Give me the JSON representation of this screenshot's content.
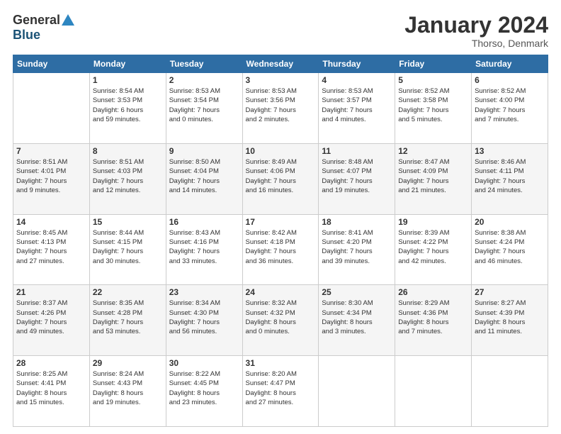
{
  "header": {
    "logo_general": "General",
    "logo_blue": "Blue",
    "title": "January 2024",
    "subtitle": "Thorso, Denmark"
  },
  "weekdays": [
    "Sunday",
    "Monday",
    "Tuesday",
    "Wednesday",
    "Thursday",
    "Friday",
    "Saturday"
  ],
  "weeks": [
    [
      {
        "day": "",
        "info": ""
      },
      {
        "day": "1",
        "info": "Sunrise: 8:54 AM\nSunset: 3:53 PM\nDaylight: 6 hours\nand 59 minutes."
      },
      {
        "day": "2",
        "info": "Sunrise: 8:53 AM\nSunset: 3:54 PM\nDaylight: 7 hours\nand 0 minutes."
      },
      {
        "day": "3",
        "info": "Sunrise: 8:53 AM\nSunset: 3:56 PM\nDaylight: 7 hours\nand 2 minutes."
      },
      {
        "day": "4",
        "info": "Sunrise: 8:53 AM\nSunset: 3:57 PM\nDaylight: 7 hours\nand 4 minutes."
      },
      {
        "day": "5",
        "info": "Sunrise: 8:52 AM\nSunset: 3:58 PM\nDaylight: 7 hours\nand 5 minutes."
      },
      {
        "day": "6",
        "info": "Sunrise: 8:52 AM\nSunset: 4:00 PM\nDaylight: 7 hours\nand 7 minutes."
      }
    ],
    [
      {
        "day": "7",
        "info": "Sunrise: 8:51 AM\nSunset: 4:01 PM\nDaylight: 7 hours\nand 9 minutes."
      },
      {
        "day": "8",
        "info": "Sunrise: 8:51 AM\nSunset: 4:03 PM\nDaylight: 7 hours\nand 12 minutes."
      },
      {
        "day": "9",
        "info": "Sunrise: 8:50 AM\nSunset: 4:04 PM\nDaylight: 7 hours\nand 14 minutes."
      },
      {
        "day": "10",
        "info": "Sunrise: 8:49 AM\nSunset: 4:06 PM\nDaylight: 7 hours\nand 16 minutes."
      },
      {
        "day": "11",
        "info": "Sunrise: 8:48 AM\nSunset: 4:07 PM\nDaylight: 7 hours\nand 19 minutes."
      },
      {
        "day": "12",
        "info": "Sunrise: 8:47 AM\nSunset: 4:09 PM\nDaylight: 7 hours\nand 21 minutes."
      },
      {
        "day": "13",
        "info": "Sunrise: 8:46 AM\nSunset: 4:11 PM\nDaylight: 7 hours\nand 24 minutes."
      }
    ],
    [
      {
        "day": "14",
        "info": "Sunrise: 8:45 AM\nSunset: 4:13 PM\nDaylight: 7 hours\nand 27 minutes."
      },
      {
        "day": "15",
        "info": "Sunrise: 8:44 AM\nSunset: 4:15 PM\nDaylight: 7 hours\nand 30 minutes."
      },
      {
        "day": "16",
        "info": "Sunrise: 8:43 AM\nSunset: 4:16 PM\nDaylight: 7 hours\nand 33 minutes."
      },
      {
        "day": "17",
        "info": "Sunrise: 8:42 AM\nSunset: 4:18 PM\nDaylight: 7 hours\nand 36 minutes."
      },
      {
        "day": "18",
        "info": "Sunrise: 8:41 AM\nSunset: 4:20 PM\nDaylight: 7 hours\nand 39 minutes."
      },
      {
        "day": "19",
        "info": "Sunrise: 8:39 AM\nSunset: 4:22 PM\nDaylight: 7 hours\nand 42 minutes."
      },
      {
        "day": "20",
        "info": "Sunrise: 8:38 AM\nSunset: 4:24 PM\nDaylight: 7 hours\nand 46 minutes."
      }
    ],
    [
      {
        "day": "21",
        "info": "Sunrise: 8:37 AM\nSunset: 4:26 PM\nDaylight: 7 hours\nand 49 minutes."
      },
      {
        "day": "22",
        "info": "Sunrise: 8:35 AM\nSunset: 4:28 PM\nDaylight: 7 hours\nand 53 minutes."
      },
      {
        "day": "23",
        "info": "Sunrise: 8:34 AM\nSunset: 4:30 PM\nDaylight: 7 hours\nand 56 minutes."
      },
      {
        "day": "24",
        "info": "Sunrise: 8:32 AM\nSunset: 4:32 PM\nDaylight: 8 hours\nand 0 minutes."
      },
      {
        "day": "25",
        "info": "Sunrise: 8:30 AM\nSunset: 4:34 PM\nDaylight: 8 hours\nand 3 minutes."
      },
      {
        "day": "26",
        "info": "Sunrise: 8:29 AM\nSunset: 4:36 PM\nDaylight: 8 hours\nand 7 minutes."
      },
      {
        "day": "27",
        "info": "Sunrise: 8:27 AM\nSunset: 4:39 PM\nDaylight: 8 hours\nand 11 minutes."
      }
    ],
    [
      {
        "day": "28",
        "info": "Sunrise: 8:25 AM\nSunset: 4:41 PM\nDaylight: 8 hours\nand 15 minutes."
      },
      {
        "day": "29",
        "info": "Sunrise: 8:24 AM\nSunset: 4:43 PM\nDaylight: 8 hours\nand 19 minutes."
      },
      {
        "day": "30",
        "info": "Sunrise: 8:22 AM\nSunset: 4:45 PM\nDaylight: 8 hours\nand 23 minutes."
      },
      {
        "day": "31",
        "info": "Sunrise: 8:20 AM\nSunset: 4:47 PM\nDaylight: 8 hours\nand 27 minutes."
      },
      {
        "day": "",
        "info": ""
      },
      {
        "day": "",
        "info": ""
      },
      {
        "day": "",
        "info": ""
      }
    ]
  ]
}
